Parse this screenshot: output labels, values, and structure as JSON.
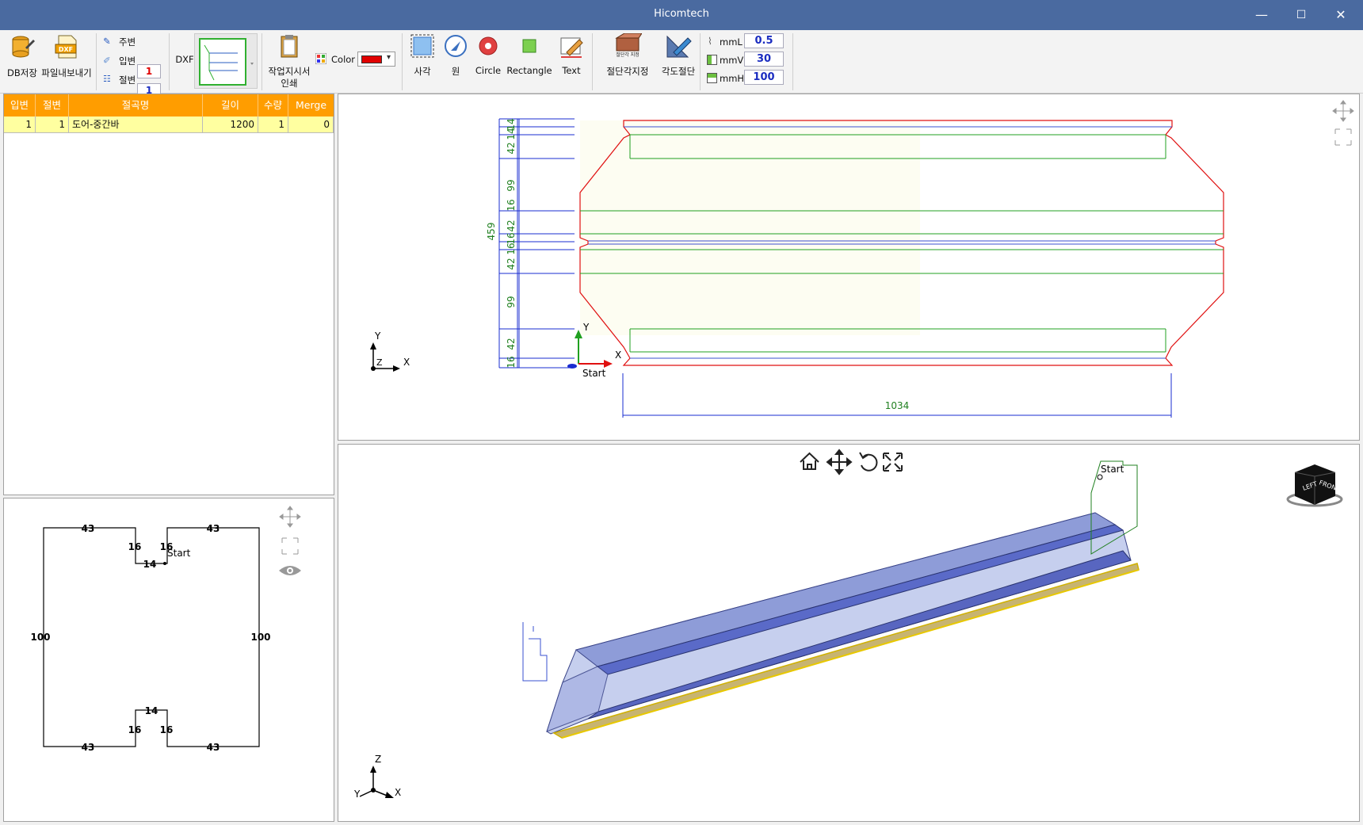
{
  "window": {
    "title": "Hicomtech",
    "minimize": "—",
    "maximize": "☐",
    "close": "✕"
  },
  "toolbar": {
    "db_save": "DB저장",
    "file_export": "파일내보내기",
    "dxf_icon_text": "DXF",
    "side1_label": "주변",
    "side1_value": "1",
    "side2_label": "입변",
    "side2_value": "1",
    "side3_label": "절변",
    "side3_value": "1",
    "dxf_label": "DXF",
    "work_print_line1": "작업지시서",
    "work_print_line2": "인쇄",
    "color_label": "Color",
    "color_value": "#e00000",
    "rect_kr": "사각",
    "circle_kr": "원",
    "circle": "Circle",
    "rectangle": "Rectangle",
    "text": "Text",
    "cut_angle_icon_text": "절단각 지정",
    "cut_angle_set": "절단각지정",
    "angle_cut": "각도절단",
    "mmL_label": "mmL",
    "mmL_value": "0.5",
    "mmV_label": "mmV",
    "mmV_value": "30",
    "mmH_label": "mmH",
    "mmH_value": "100"
  },
  "table": {
    "headers": [
      "입변",
      "절변",
      "절곡명",
      "길이",
      "수량",
      "Merge"
    ],
    "rows": [
      [
        "1",
        "1",
        "도어-중간바",
        "1200",
        "1",
        "0"
      ]
    ]
  },
  "profile": {
    "top_left": "43",
    "top_right": "43",
    "notch_left": "16",
    "notch_right": "16",
    "notch_bottom": "14",
    "start": "Start",
    "left_side": "100",
    "right_side": "100",
    "bottom_notch_top": "14",
    "bottom_notch_left": "16",
    "bottom_notch_right": "16",
    "bottom_left": "43",
    "bottom_right": "43"
  },
  "drawing2d": {
    "dims": [
      "459",
      "42",
      "99",
      "16",
      "42",
      "16",
      "16",
      "42",
      "99",
      "42",
      "16",
      "14",
      "14"
    ],
    "width_dim": "1034",
    "axis_y": "Y",
    "axis_x": "X",
    "axis_z": "Z",
    "start": "Start"
  },
  "view3d": {
    "start": "Start",
    "cube_left": "LEFT",
    "cube_front": "FRONT",
    "axis_z": "Z",
    "axis_x": "X",
    "axis_y": "Y"
  }
}
